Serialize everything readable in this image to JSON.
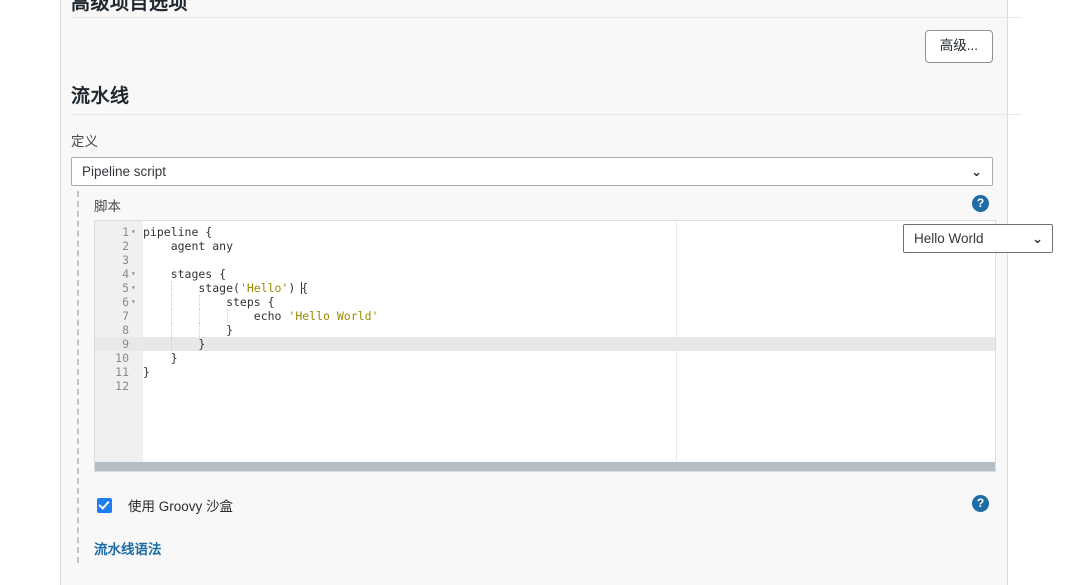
{
  "sections": {
    "advanced_project_options": {
      "heading": "高级项目选项",
      "advanced_button": "高级..."
    },
    "pipeline": {
      "heading": "流水线",
      "definition_label": "定义",
      "definition_value": "Pipeline script",
      "script_label": "脚本",
      "sample_pipeline_value": "Hello World",
      "sandbox_label": "使用 Groovy 沙盒",
      "sandbox_checked": true,
      "syntax_link": "流水线语法"
    }
  },
  "icons": {
    "help": "?",
    "chevron_down": "⌄"
  },
  "editor": {
    "active_line": 9,
    "lines": [
      {
        "num": "1",
        "fold": "▾",
        "indent_guides": [],
        "text": "pipeline {"
      },
      {
        "num": "2",
        "fold": "",
        "indent_guides": [],
        "text": "    agent any"
      },
      {
        "num": "3",
        "fold": "",
        "indent_guides": [],
        "text": ""
      },
      {
        "num": "4",
        "fold": "▾",
        "indent_guides": [],
        "text": "    stages {"
      },
      {
        "num": "5",
        "fold": "▾",
        "indent_guides": [
          76
        ],
        "text": "        stage('Hello') {"
      },
      {
        "num": "6",
        "fold": "▾",
        "indent_guides": [
          76,
          104
        ],
        "text": "            steps {"
      },
      {
        "num": "7",
        "fold": "",
        "indent_guides": [
          76,
          104,
          132
        ],
        "text": "                echo 'Hello World'"
      },
      {
        "num": "8",
        "fold": "",
        "indent_guides": [
          76,
          104
        ],
        "text": "            }"
      },
      {
        "num": "9",
        "fold": "",
        "indent_guides": [
          76
        ],
        "text": "        }"
      },
      {
        "num": "10",
        "fold": "",
        "indent_guides": [],
        "text": "    }"
      },
      {
        "num": "11",
        "fold": "",
        "indent_guides": [],
        "text": "}"
      },
      {
        "num": "12",
        "fold": "",
        "indent_guides": [],
        "text": ""
      }
    ]
  },
  "colors": {
    "accent_link": "#1d6ba6",
    "help_icon_bg": "#1e6ca3",
    "checkbox_blue": "#1d7df4",
    "string_token": "#9a8a00",
    "panel_bg": "#f8f8f8"
  }
}
